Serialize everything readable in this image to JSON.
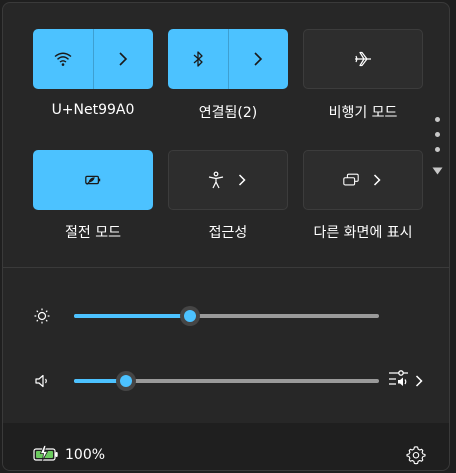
{
  "quick_settings": {
    "wifi": {
      "label": "U+Net99A0",
      "icon": "wifi-icon",
      "active": true
    },
    "bluetooth": {
      "label": "연결됨(2)",
      "icon": "bluetooth-icon",
      "active": true
    },
    "airplane": {
      "label": "비행기 모드",
      "icon": "airplane-icon",
      "active": false
    },
    "battery_saver": {
      "label": "절전 모드",
      "icon": "battery-saver-icon",
      "active": true
    },
    "accessibility": {
      "label": "접근성",
      "icon": "accessibility-icon",
      "active": false
    },
    "project": {
      "label": "다른 화면에 표시",
      "icon": "project-icon",
      "active": false
    }
  },
  "sliders": {
    "brightness": {
      "icon": "brightness-icon",
      "percent": 38
    },
    "volume": {
      "icon": "volume-icon",
      "percent": 17
    }
  },
  "footer": {
    "battery_text": "100%",
    "battery_icon": "battery-charging-icon",
    "settings_icon": "gear-icon"
  },
  "colors": {
    "accent": "#4cc2ff",
    "panel": "#272727",
    "tile_off": "#2d2d2d",
    "footer": "#1f1f1f"
  }
}
